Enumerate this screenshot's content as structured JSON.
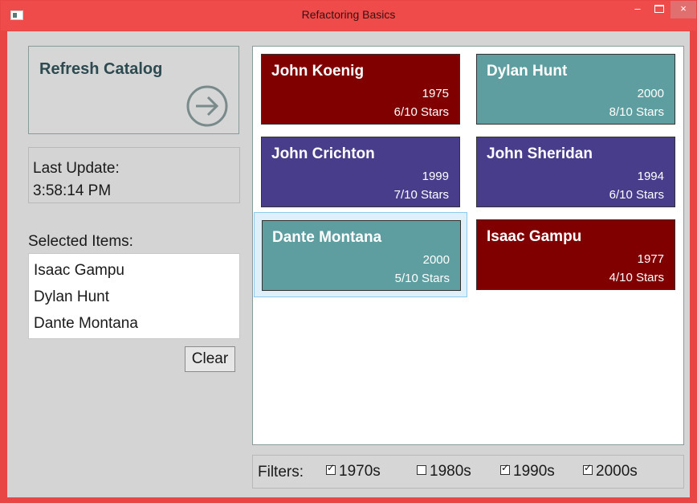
{
  "window": {
    "title": "Refactoring Basics",
    "minimize": "–",
    "close": "×"
  },
  "refresh": {
    "label": "Refresh Catalog",
    "icon": "arrow-right-circle-icon"
  },
  "last_update": {
    "label": "Last Update:",
    "time": "3:58:14 PM"
  },
  "selected": {
    "label": "Selected Items:",
    "items": [
      "Isaac Gampu",
      "Dylan Hunt",
      "Dante Montana"
    ],
    "clear_label": "Clear"
  },
  "catalog": {
    "cards": [
      {
        "name": "John Koenig",
        "year": "1975",
        "stars": "6/10 Stars",
        "color": "#800000"
      },
      {
        "name": "Dylan Hunt",
        "year": "2000",
        "stars": "8/10 Stars",
        "color": "#5f9ea0"
      },
      {
        "name": "John Crichton",
        "year": "1999",
        "stars": "7/10 Stars",
        "color": "#483d8b"
      },
      {
        "name": "John Sheridan",
        "year": "1994",
        "stars": "6/10 Stars",
        "color": "#483d8b"
      },
      {
        "name": "Dante Montana",
        "year": "2000",
        "stars": "5/10 Stars",
        "color": "#5f9ea0",
        "selected": true
      },
      {
        "name": "Isaac Gampu",
        "year": "1977",
        "stars": "4/10 Stars",
        "color": "#800000"
      }
    ]
  },
  "filters": {
    "label": "Filters:",
    "options": [
      {
        "label": "1970s",
        "checked": true
      },
      {
        "label": "1980s",
        "checked": false
      },
      {
        "label": "1990s",
        "checked": true
      },
      {
        "label": "2000s",
        "checked": true
      }
    ]
  }
}
